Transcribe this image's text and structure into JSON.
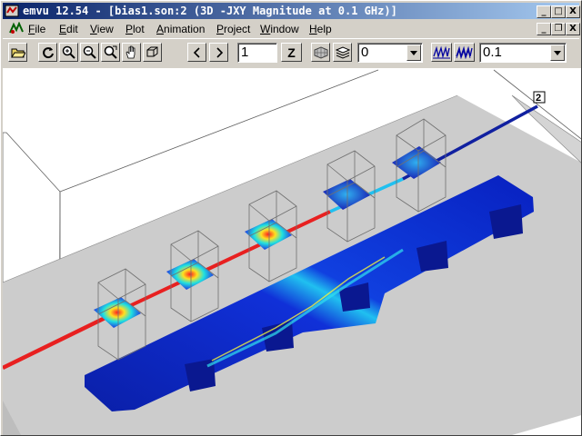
{
  "window": {
    "title": "emvu 12.54 - [bias1.son:2 (3D -JXY Magnitude at 0.1 GHz)]",
    "minimize": "_",
    "maximize": "□",
    "close": "X"
  },
  "menu": {
    "items": [
      "File",
      "Edit",
      "View",
      "Plot",
      "Animation",
      "Project",
      "Window",
      "Help"
    ],
    "mdi_minimize": "_",
    "mdi_restore": "❐",
    "mdi_close": "X"
  },
  "toolbar": {
    "level_value": "1",
    "z_label": "Z",
    "frame_select": "0",
    "freq_select": "0.1"
  },
  "view": {
    "port_label": "2"
  }
}
